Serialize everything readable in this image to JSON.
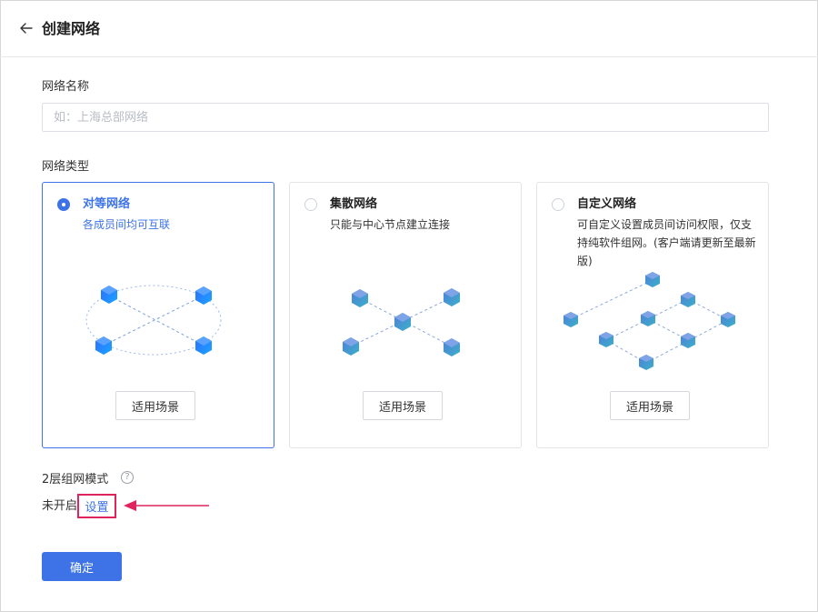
{
  "header": {
    "title": "创建网络",
    "back_icon": "arrow-left-icon"
  },
  "form": {
    "name_label": "网络名称",
    "name_placeholder": "如：上海总部网络",
    "name_value": "",
    "type_label": "网络类型",
    "cards": [
      {
        "title": "对等网络",
        "desc": "各成员间均可互联",
        "button": "适用场景",
        "selected": true
      },
      {
        "title": "集散网络",
        "desc": "只能与中心节点建立连接",
        "button": "适用场景",
        "selected": false
      },
      {
        "title": "自定义网络",
        "desc": "可自定义设置成员间访问权限，仅支持纯软件组网。(客户端请更新至最新版)",
        "button": "适用场景",
        "selected": false
      }
    ],
    "layer2_label": "2层组网模式",
    "help_glyph": "?",
    "layer2_status": "未开启",
    "layer2_link": "设置",
    "confirm_button": "确定"
  },
  "colors": {
    "accent": "#3d73e6",
    "highlight": "#e0245e",
    "border": "#e2e4e8"
  }
}
